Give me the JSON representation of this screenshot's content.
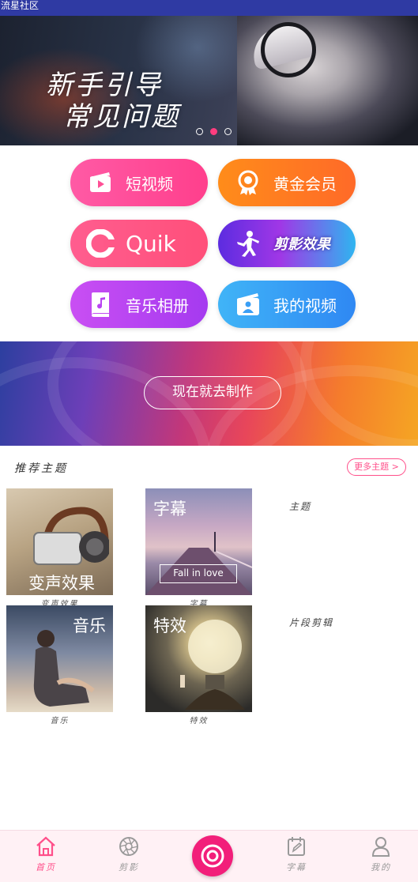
{
  "status_bar": {
    "title": "流星社区"
  },
  "banner": {
    "line1": "新手引导",
    "line2": "常见问题",
    "dots_count": 3,
    "active_dot": 1
  },
  "shortcuts": {
    "short_video": "短视频",
    "gold_member": "黄金会员",
    "quik": "Quik",
    "edit_effect": "剪影效果",
    "music_album": "音乐相册",
    "my_videos": "我的视频"
  },
  "promo": {
    "button_label": "现在就去制作"
  },
  "topics": {
    "section_title": "推荐主题",
    "more_label": "更多主题 >",
    "tiles": [
      {
        "overlay": "变声效果",
        "caption": "变声效果"
      },
      {
        "overlay": "字幕",
        "badge": "Fall in love",
        "caption": "字幕"
      },
      {
        "overlay": "音乐",
        "caption": "音乐"
      },
      {
        "overlay": "特效",
        "caption": "特效"
      }
    ],
    "side_labels": [
      "主题",
      "片段剪辑"
    ]
  },
  "bottom_nav": {
    "items": [
      {
        "label": "首页",
        "icon": "home-icon",
        "active": true
      },
      {
        "label": "剪影",
        "icon": "aperture-icon",
        "active": false
      },
      {
        "label": "字幕",
        "icon": "calendar-edit-icon",
        "active": false
      },
      {
        "label": "我的",
        "icon": "user-icon",
        "active": false
      }
    ],
    "center_icon": "record-icon"
  },
  "colors": {
    "accent": "#ff4f8a",
    "status_bar": "#2f3aa3",
    "center_button": "#f21f7a"
  }
}
